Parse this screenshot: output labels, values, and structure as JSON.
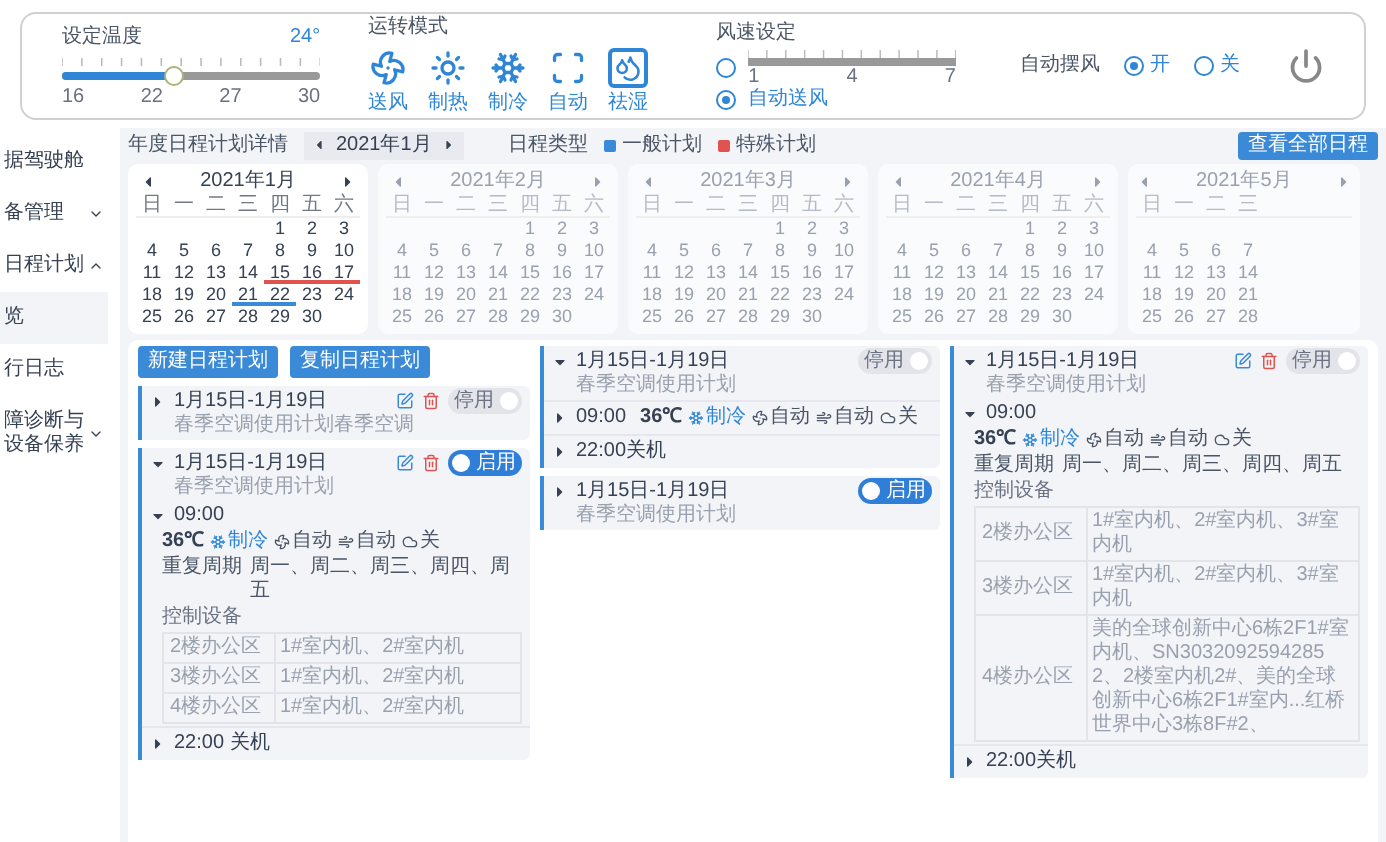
{
  "top_panel": {
    "temperature": {
      "label": "设定温度",
      "value": "24°",
      "level": 0.43,
      "ticks": [
        "16",
        "22",
        "27",
        "30"
      ]
    },
    "mode": {
      "label": "运转模式",
      "options": [
        {
          "kind": "fan",
          "label": "送风",
          "selected": false
        },
        {
          "kind": "heat",
          "label": "制热",
          "selected": false
        },
        {
          "kind": "cool",
          "label": "制冷",
          "selected": false
        },
        {
          "kind": "auto",
          "label": "自动",
          "selected": false
        },
        {
          "kind": "dehumidify",
          "label": "祛湿",
          "selected": true
        }
      ]
    },
    "wind": {
      "label": "风速设定",
      "manual_selected": false,
      "ticks": [
        "1",
        "4",
        "7"
      ],
      "auto_label": "自动送风",
      "auto_selected": true
    },
    "swing": {
      "label": "自动摆风",
      "options": [
        {
          "label": "开",
          "selected": true
        },
        {
          "label": "关",
          "selected": false
        }
      ]
    }
  },
  "sidebar": {
    "items": [
      {
        "label": "据驾驶舱",
        "selected": false
      },
      {
        "label": "备管理",
        "selected": false,
        "expanded": false
      },
      {
        "label": "日程计划",
        "selected": false,
        "expanded": true,
        "children": [
          {
            "label": "览",
            "selected": true
          },
          {
            "label": "行日志",
            "selected": false
          }
        ]
      },
      {
        "label": "障诊断与设备保养",
        "selected": false,
        "expanded": false
      }
    ]
  },
  "schedule_header": {
    "title": "年度日程计划详情",
    "month": "2021年1月",
    "type_label": "日程类型",
    "legend": [
      {
        "label": "一般计划",
        "color": "#3a8ad8"
      },
      {
        "label": "特殊计划",
        "color": "#e0534f"
      }
    ],
    "view_all_button": "查看全部日程"
  },
  "calendars": [
    {
      "title": "2021年1月",
      "selected": true,
      "weekdays": [
        "日",
        "一",
        "二",
        "三",
        "四",
        "五",
        "六"
      ],
      "weeks": [
        [
          "1",
          "2",
          "3"
        ],
        [
          "4",
          "5",
          "6",
          "7",
          "8",
          "9",
          "10"
        ],
        [
          "11",
          "12",
          "13",
          "14",
          {
            "day": "15",
            "color": "#e0534f"
          },
          {
            "day": "16",
            "color": "#e0534f"
          },
          {
            "day": "17",
            "color": "#e0534f"
          }
        ],
        [
          "18",
          "19",
          "20",
          {
            "day": "21",
            "color": "#3a8ad8"
          },
          {
            "day": "22",
            "color": "#3a8ad8"
          },
          "23",
          "24"
        ],
        [
          "25",
          "26",
          "27",
          "28",
          "29",
          "30"
        ]
      ]
    },
    {
      "title": "2021年2月",
      "selected": false,
      "weekdays": [
        "日",
        "一",
        "二",
        "三",
        "四",
        "五",
        "六"
      ],
      "weeks": [
        [
          "1",
          "2",
          "3"
        ],
        [
          "4",
          "5",
          "6",
          "7",
          "8",
          "9",
          "10"
        ],
        [
          "11",
          "12",
          "13",
          "14",
          "15",
          "16",
          "17"
        ],
        [
          "18",
          "19",
          "20",
          "21",
          "22",
          "23",
          "24"
        ],
        [
          "25",
          "26",
          "27",
          "28",
          "29",
          "30"
        ]
      ]
    },
    {
      "title": "2021年3月",
      "selected": false,
      "weekdays": [
        "日",
        "一",
        "二",
        "三",
        "四",
        "五",
        "六"
      ],
      "weeks": [
        [
          "1",
          "2",
          "3"
        ],
        [
          "4",
          "5",
          "6",
          "7",
          "8",
          "9",
          "10"
        ],
        [
          "11",
          "12",
          "13",
          "14",
          "15",
          "16",
          "17"
        ],
        [
          "18",
          "19",
          "20",
          "21",
          "22",
          "23",
          "24"
        ],
        [
          "25",
          "26",
          "27",
          "28",
          "29",
          "30"
        ]
      ]
    },
    {
      "title": "2021年4月",
      "selected": false,
      "weekdays": [
        "日",
        "一",
        "二",
        "三",
        "四",
        "五",
        "六"
      ],
      "weeks": [
        [
          "1",
          "2",
          "3"
        ],
        [
          "4",
          "5",
          "6",
          "7",
          "8",
          "9",
          "10"
        ],
        [
          "11",
          "12",
          "13",
          "14",
          "15",
          "16",
          "17"
        ],
        [
          "18",
          "19",
          "20",
          "21",
          "22",
          "23",
          "24"
        ],
        [
          "25",
          "26",
          "27",
          "28",
          "29",
          "30"
        ]
      ]
    },
    {
      "title": "2021年5月",
      "selected": false,
      "weekdays": [
        "日",
        "一",
        "二",
        "三"
      ],
      "weeks": [
        [
          "4",
          "5",
          "6",
          "7"
        ],
        [
          "11",
          "12",
          "13",
          "14"
        ],
        [
          "18",
          "19",
          "20",
          "21"
        ],
        [
          "25",
          "26",
          "27",
          "28"
        ]
      ]
    }
  ],
  "plans": {
    "actions": [
      "新建日程计划",
      "复制日程计划"
    ],
    "columns": [
      [
        {
          "date": "1月15日-1月19日",
          "name": "春季空调使用计划春季空调",
          "expanded": false,
          "editable": true,
          "switch": {
            "label": "停用",
            "on": false
          }
        },
        {
          "date": "1月15日-1月19日",
          "name": "春季空调使用计划",
          "expanded": true,
          "editable": true,
          "switch": {
            "label": "启用",
            "on": true
          },
          "events": [
            {
              "kind": "run",
              "time": "09:00",
              "expanded": true,
              "settings": {
                "temperature": "36℃",
                "mode": "制冷",
                "fan": "自动",
                "swing": "自动",
                "humidity": "关"
              },
              "repeat_label": "重复周期",
              "repeat": "周一、周二、周三、周四、周五",
              "devices_label": "控制设备",
              "devices": [
                {
                  "area": "2楼办公区",
                  "units": "1#室内机、2#室内机"
                },
                {
                  "area": "3楼办公区",
                  "units": "1#室内机、2#室内机"
                },
                {
                  "area": "4楼办公区",
                  "units": "1#室内机、2#室内机"
                }
              ]
            },
            {
              "kind": "shutdown",
              "time": "22:00 关机"
            }
          ]
        }
      ],
      [
        {
          "date": "1月15日-1月19日",
          "name": "春季空调使用计划",
          "expanded": true,
          "editable": false,
          "switch": {
            "label": "停用",
            "on": false
          },
          "events": [
            {
              "kind": "run",
              "time": "09:00",
              "expanded": false,
              "settings": {
                "temperature": "36℃",
                "mode": "制冷",
                "fan": "自动",
                "swing": "自动",
                "humidity": "关"
              }
            },
            {
              "kind": "shutdown",
              "time": "22:00关机"
            }
          ]
        },
        {
          "date": "1月15日-1月19日",
          "name": "春季空调使用计划",
          "expanded": false,
          "editable": false,
          "switch": {
            "label": "启用",
            "on": true
          }
        }
      ],
      [
        {
          "date": "1月15日-1月19日",
          "name": "春季空调使用计划",
          "expanded": true,
          "editable": true,
          "switch": {
            "label": "停用",
            "on": false
          },
          "events": [
            {
              "kind": "run",
              "time": "09:00",
              "expanded": true,
              "settings": {
                "temperature": "36℃",
                "mode": "制冷",
                "fan": "自动",
                "swing": "自动",
                "humidity": "关"
              },
              "repeat_label": "重复周期",
              "repeat": "周一、周二、周三、周四、周五",
              "devices_label": "控制设备",
              "devices": [
                {
                  "area": "2楼办公区",
                  "units": "1#室内机、2#室内机、3#室内机"
                },
                {
                  "area": "3楼办公区",
                  "units": "1#室内机、2#室内机、3#室内机"
                },
                {
                  "area": "4楼办公区",
                  "units": "美的全球创新中心6栋2F1#室内机、SN30320925942852、2楼室内机2#、美的全球创新中心6栋2F1#室内...红桥世界中心3栋8F#2、"
                }
              ]
            },
            {
              "kind": "shutdown",
              "time": "22:00关机"
            }
          ]
        }
      ]
    ]
  }
}
